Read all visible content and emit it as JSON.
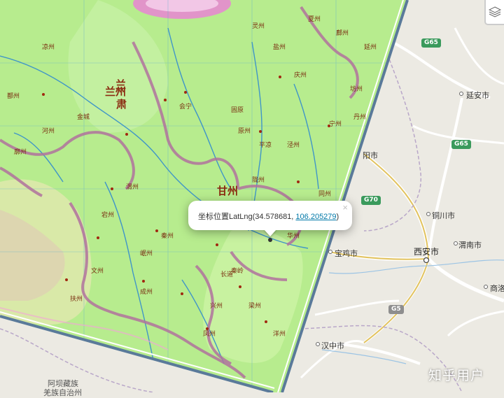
{
  "map": {
    "modern_cities": [
      "延安市",
      "铜川市",
      "西安市",
      "渭南市",
      "宝鸡市",
      "汉中市",
      "商洛",
      "阳市"
    ],
    "modern_regions": [
      "阿坝藏族",
      "羌族自治州"
    ],
    "road_shields": [
      "G65",
      "G65",
      "G70",
      "G5"
    ],
    "historic_labels": [
      "兰州",
      "秦州",
      "成州",
      "凤州",
      "陇州",
      "渭州",
      "原州",
      "泾州",
      "宁州",
      "庆州",
      "会宁",
      "鄜州",
      "坊州",
      "同州",
      "华州",
      "洋州",
      "兴州",
      "梁州",
      "文州",
      "扶州",
      "宕州",
      "秦岭",
      "甘州",
      "兰",
      "肃",
      "岷州",
      "河州",
      "廓州",
      "鄯州",
      "凉州",
      "灵州",
      "盐州",
      "夏州",
      "延州",
      "丹州",
      "金城",
      "长道",
      "平凉",
      "固原"
    ],
    "colors": {
      "historic_fill": "#b7ec8e",
      "historic_fill_alt": "#c7f09a",
      "border_purple": "#b1729e",
      "river": "#3f95c8",
      "modern_base": "#eceae3",
      "modern_road": "#ffffff",
      "highway_green": "#3a9a5c"
    }
  },
  "popup": {
    "label": "坐标位置LatLng(34.578681, ",
    "lng_link": "106.205279",
    "suffix": ")",
    "close_symbol": "×"
  },
  "layers_control": {
    "icon": "layers-icon"
  },
  "watermark": {
    "text": "知乎用户"
  }
}
